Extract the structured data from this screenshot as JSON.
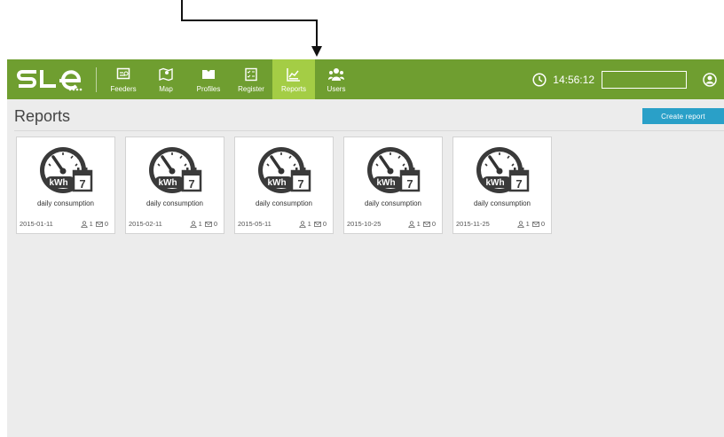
{
  "nav": {
    "logo": "SLE",
    "items": [
      {
        "label": "Feeders",
        "icon": "feeders-icon"
      },
      {
        "label": "Map",
        "icon": "map-icon"
      },
      {
        "label": "Profiles",
        "icon": "profiles-icon"
      },
      {
        "label": "Register",
        "icon": "register-icon"
      },
      {
        "label": "Reports",
        "icon": "reports-icon",
        "active": true
      },
      {
        "label": "Users",
        "icon": "users-icon"
      }
    ],
    "clock": "14:56:12",
    "search_value": ""
  },
  "page": {
    "title": "Reports",
    "create_button": "Create report"
  },
  "reports": [
    {
      "name": "daily consumption",
      "date": "2015-01-11",
      "users": "1",
      "emails": "0"
    },
    {
      "name": "daily consumption",
      "date": "2015-02-11",
      "users": "1",
      "emails": "0"
    },
    {
      "name": "daily consumption",
      "date": "2015-05-11",
      "users": "1",
      "emails": "0"
    },
    {
      "name": "daily consumption",
      "date": "2015-10-25",
      "users": "1",
      "emails": "0"
    },
    {
      "name": "daily consumption",
      "date": "2015-11-25",
      "users": "1",
      "emails": "0"
    }
  ],
  "report_icon": {
    "unit": "kWh",
    "day": "7"
  },
  "colors": {
    "nav_bg": "#6f9e30",
    "nav_active": "#a4cd45",
    "button": "#2aa0c8",
    "content_bg": "#ececec"
  }
}
